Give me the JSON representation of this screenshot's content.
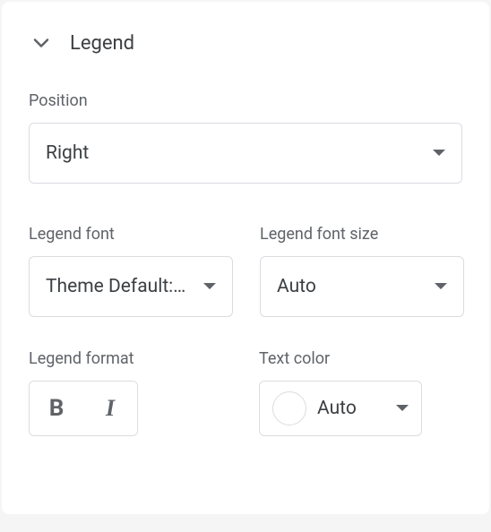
{
  "section": {
    "title": "Legend"
  },
  "position": {
    "label": "Position",
    "value": "Right"
  },
  "font": {
    "label": "Legend font",
    "value": "Theme Default:…"
  },
  "fontSize": {
    "label": "Legend font size",
    "value": "Auto"
  },
  "format": {
    "label": "Legend format",
    "bold": "B",
    "italic": "I"
  },
  "textColor": {
    "label": "Text color",
    "value": "Auto"
  }
}
